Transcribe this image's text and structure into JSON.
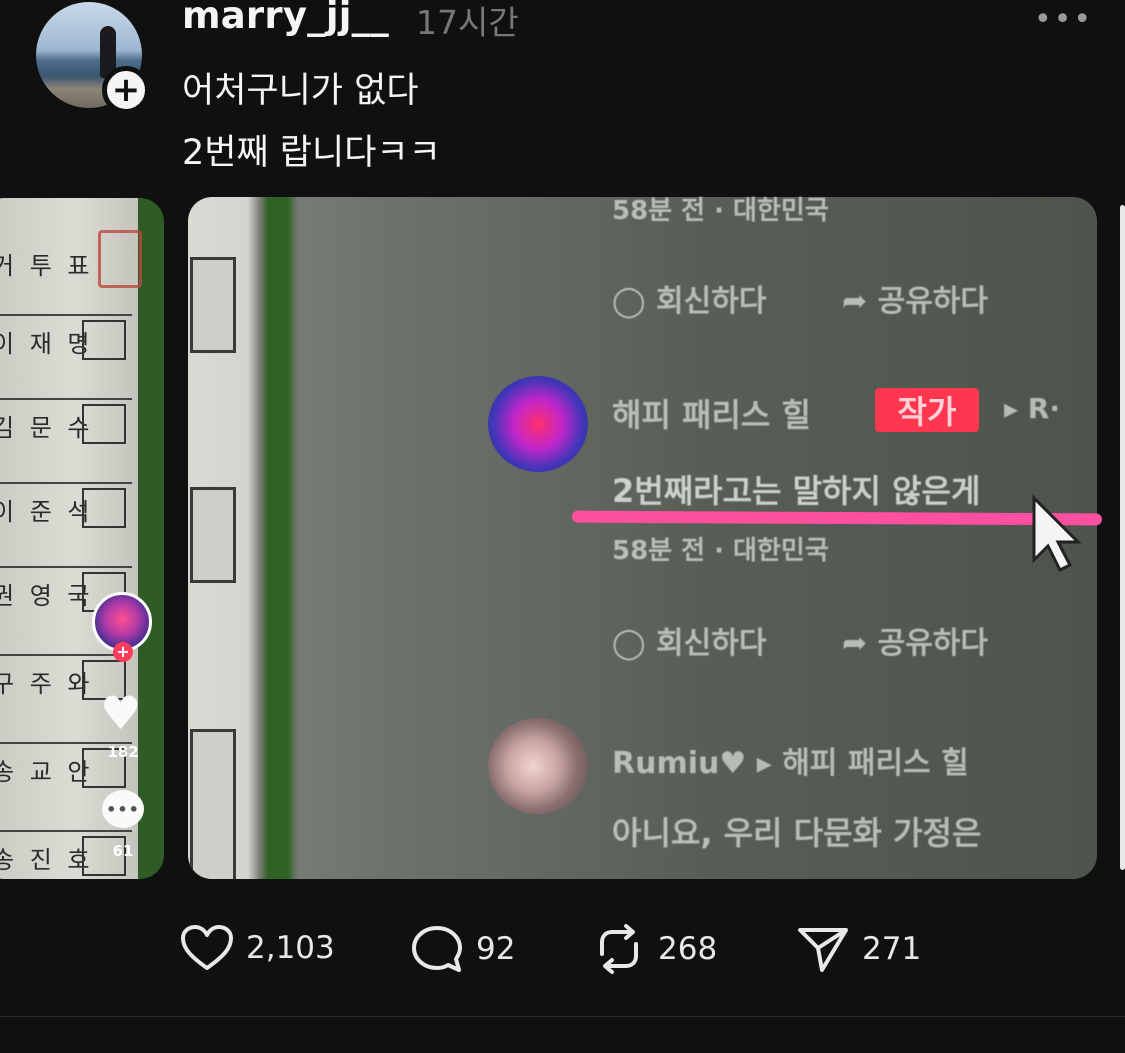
{
  "post": {
    "username": "marry_jj__",
    "time": "17시간",
    "text_line1": "어처구니가 없다",
    "text_line2": "2번째 랍니다ㅋㅋ",
    "more_label": "•••"
  },
  "media_left": {
    "ballot_rows": [
      "거 투 표",
      "이 재 명",
      "김 문 수",
      "이 준 석",
      "권 영 국",
      "구 주 와",
      "송 교 안",
      "송 진 호"
    ],
    "like_count": "182",
    "comment_count": "61",
    "comment_bubble": "•••"
  },
  "media_main": {
    "top_line": "58분 전 · 대한민국",
    "reply_label": "회신하다",
    "share_label": "공유하다",
    "comment1_author": "해피 패리스 힐",
    "comment1_badge": "작가",
    "comment1_target": "▸ R·",
    "comment1_text": "2번째라고는 말하지 않은게",
    "comment1_meta": "58분 전 · 대한민국",
    "comment2_author": "Rumiu♥ ▸ 해피 패리스 힐",
    "comment2_text": "아니요, 우리 다문화 가정은"
  },
  "actions": {
    "likes": "2,103",
    "comments": "92",
    "reposts": "268",
    "shares": "271"
  },
  "colors": {
    "background": "#101010",
    "text": "#f3f5f7",
    "muted": "#777777",
    "badge_red": "#ff3650",
    "highlight_pink": "#ff4fa0"
  }
}
